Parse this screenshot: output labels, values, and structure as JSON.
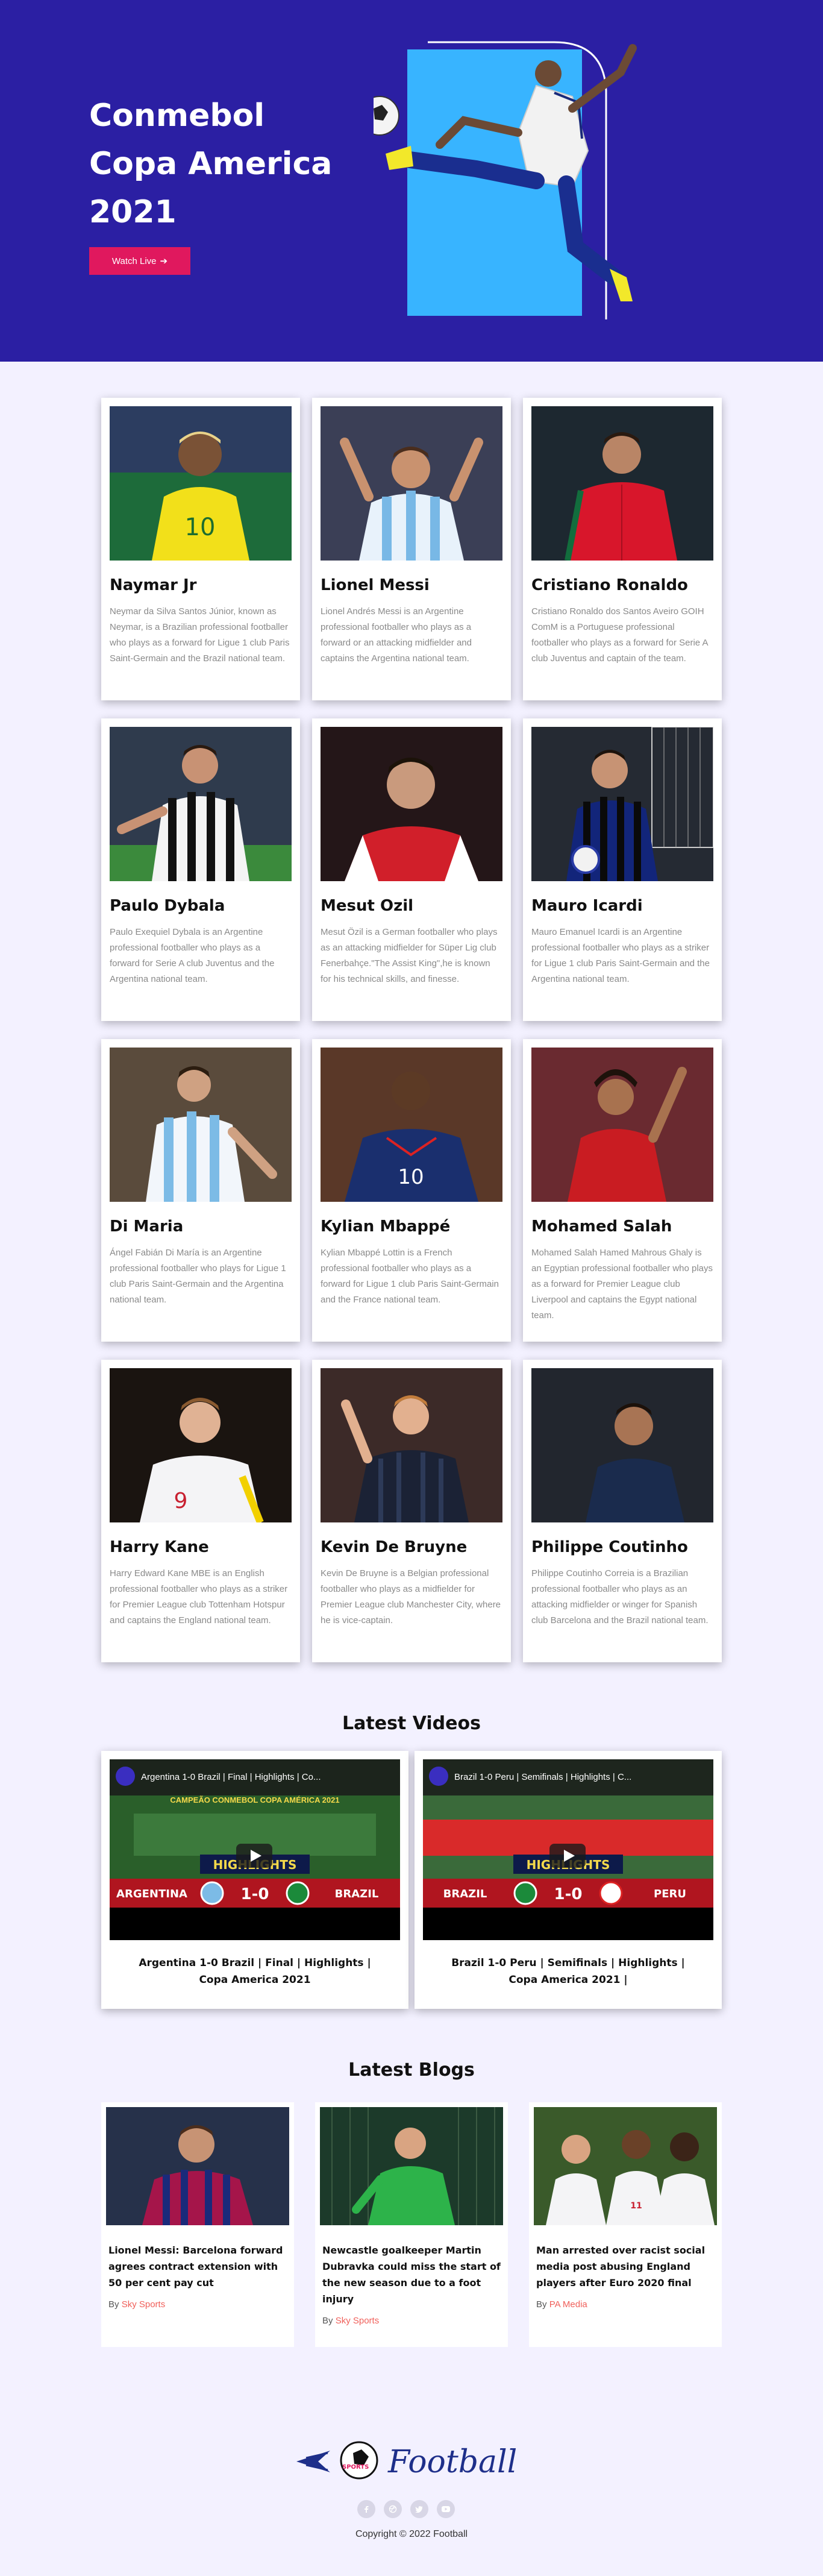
{
  "hero": {
    "title_lines": [
      "Conmebol",
      "Copa America",
      "2021"
    ],
    "watch_label": "Watch Live",
    "accent": "#e0185e",
    "background": "#2b1fa3"
  },
  "players": [
    {
      "name": "Naymar Jr",
      "desc": "Neymar da Silva Santos Júnior, known as Neymar, is a Brazilian professional footballer who plays as a forward for Ligue 1 club Paris Saint-Germain and the Brazil national team."
    },
    {
      "name": "Lionel Messi",
      "desc": "Lionel Andrés Messi is an Argentine professional footballer who plays as a forward or an attacking midfielder and captains the Argentina national team."
    },
    {
      "name": "Cristiano Ronaldo",
      "desc": "Cristiano Ronaldo dos Santos Aveiro GOIH ComM is a Portuguese professional footballer who plays as a forward for Serie A club Juventus and captain of the team."
    },
    {
      "name": "Paulo Dybala",
      "desc": "Paulo Exequiel Dybala is an Argentine professional footballer who plays as a forward for Serie A club Juventus and the Argentina national team."
    },
    {
      "name": "Mesut Ozil",
      "desc": "Mesut Özil is a German footballer who plays as an attacking midfielder for Süper Lig club Fenerbahçe.\"The Assist King\",he is known for his technical skills, and finesse."
    },
    {
      "name": "Mauro Icardi",
      "desc": "Mauro Emanuel Icardi is an Argentine professional footballer who plays as a striker for Ligue 1 club Paris Saint-Germain and the Argentina national team."
    },
    {
      "name": "Di Maria",
      "desc": "Ángel Fabián Di María is an Argentine professional footballer who plays for Ligue 1 club Paris Saint-Germain and the Argentina national team."
    },
    {
      "name": "Kylian Mbappé",
      "desc": "Kylian Mbappé Lottin is a French professional footballer who plays as a forward for Ligue 1 club Paris Saint-Germain and the France national team."
    },
    {
      "name": "Mohamed Salah",
      "desc": "Mohamed Salah Hamed Mahrous Ghaly is an Egyptian professional footballer who plays as a forward for Premier League club Liverpool and captains the Egypt national team."
    },
    {
      "name": "Harry Kane",
      "desc": "Harry Edward Kane MBE is an English professional footballer who plays as a striker for Premier League club Tottenham Hotspur and captains the England national team."
    },
    {
      "name": "Kevin De Bruyne",
      "desc": "Kevin De Bruyne is a Belgian professional footballer who plays as a midfielder for Premier League club Manchester City, where he is vice-captain."
    },
    {
      "name": "Philippe Coutinho",
      "desc": "Philippe Coutinho Correia is a Brazilian professional footballer who plays as an attacking midfielder or winger for Spanish club Barcelona and the Brazil national team."
    }
  ],
  "videos_section": {
    "title": "Latest Videos"
  },
  "videos": [
    {
      "thumb_title": "Argentina 1-0 Brazil | Final | Highlights | Co...",
      "banner": "CAMPEÃO CONMEBOL COPA AMÉRICA 2021",
      "badge": "HIGHLIGHTS",
      "team_left": "ARGENTINA",
      "score": "1-0",
      "team_right": "BRAZIL",
      "title": "Argentina 1-0 Brazil | Final | Highlights | Copa America 2021"
    },
    {
      "thumb_title": "Brazil 1-0 Peru | Semifinals | Highlights | C...",
      "banner": "",
      "badge": "HIGHLIGHTS",
      "team_left": "BRAZIL",
      "score": "1-0",
      "team_right": "PERU",
      "title": "Brazil 1-0 Peru | Semifinals | Highlights | Copa America 2021 |"
    }
  ],
  "blogs_section": {
    "title": "Latest Blogs"
  },
  "blogs": [
    {
      "title": "Lionel Messi: Barcelona forward agrees contract extension with 50 per cent pay cut",
      "by": "By",
      "source": "Sky Sports"
    },
    {
      "title": "Newcastle goalkeeper Martin Dubravka could miss the start of the new season due to a foot injury",
      "by": "By",
      "source": "Sky Sports"
    },
    {
      "title": "Man arrested over racist social media post abusing England players after Euro 2020 final",
      "by": "By",
      "source": "PA Media"
    }
  ],
  "footer": {
    "logo_text": "Football",
    "logo_badge": "SPORTS",
    "socials": [
      "facebook-icon",
      "dribbble-icon",
      "twitter-icon",
      "youtube-icon"
    ],
    "copyright": "Copyright © 2022 Football"
  }
}
